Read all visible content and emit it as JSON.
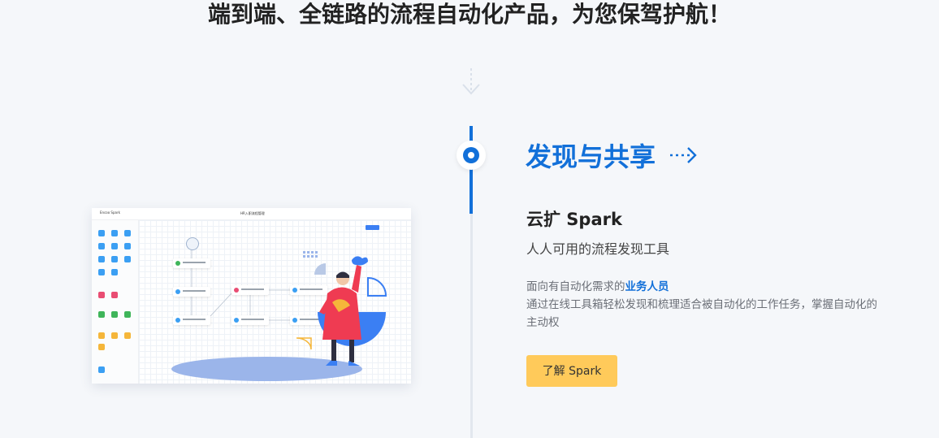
{
  "headline": "端到端、全链路的流程自动化产品，为您保驾护航！",
  "section": {
    "title": "发现与共享",
    "product_name": "云扩 Spark",
    "product_sub": "人人可用的流程发现工具",
    "desc_prefix": "面向有自动化需求的",
    "desc_highlight": "业务人员",
    "desc_rest": "通过在线工具箱轻松发现和梳理适合被自动化的工作任务，掌握自动化的主动权",
    "button_label": "了解 Spark"
  },
  "illustration": {
    "brand": "Encoo Spark",
    "canvas_title": "HR入职流程管理"
  },
  "colors": {
    "accent": "#1270d9",
    "button": "#ffca5a",
    "timeline": "#e2e7ee"
  }
}
